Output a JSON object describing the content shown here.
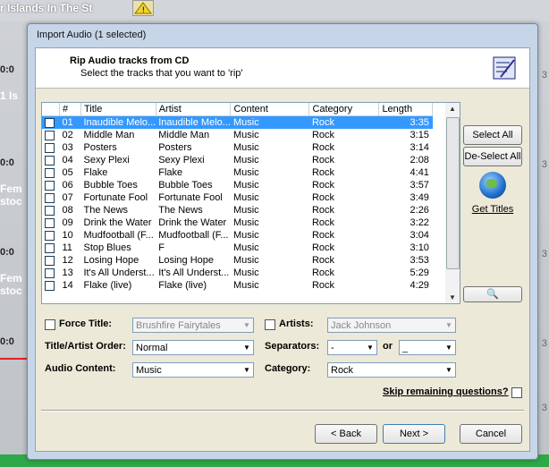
{
  "background": {
    "top_text": "r Islands In The St",
    "times": [
      "0:0",
      "0:0",
      "0:0",
      "0:0"
    ],
    "snippets": [
      "1 Is",
      "Fem",
      "stoc",
      "Fem",
      "stoc"
    ],
    "right_nums": [
      "3",
      "3",
      "3",
      "3",
      "3",
      "3"
    ]
  },
  "dialog": {
    "title": "Import Audio (1 selected)",
    "header": {
      "title": "Rip Audio tracks from CD",
      "subtitle": "Select the tracks that you want to 'rip'"
    },
    "columns": [
      "#",
      "Title",
      "Artist",
      "Content",
      "Category",
      "Length"
    ],
    "tracks": [
      {
        "num": "01",
        "title": "Inaudible Melo...",
        "artist": "Inaudible Melo...",
        "content": "Music",
        "category": "Rock",
        "length": "3:35",
        "selected": true
      },
      {
        "num": "02",
        "title": "Middle Man",
        "artist": "Middle Man",
        "content": "Music",
        "category": "Rock",
        "length": "3:15"
      },
      {
        "num": "03",
        "title": "Posters",
        "artist": "Posters",
        "content": "Music",
        "category": "Rock",
        "length": "3:14"
      },
      {
        "num": "04",
        "title": "Sexy Plexi",
        "artist": "Sexy Plexi",
        "content": "Music",
        "category": "Rock",
        "length": "2:08"
      },
      {
        "num": "05",
        "title": "Flake",
        "artist": "Flake",
        "content": "Music",
        "category": "Rock",
        "length": "4:41"
      },
      {
        "num": "06",
        "title": "Bubble Toes",
        "artist": "Bubble Toes",
        "content": "Music",
        "category": "Rock",
        "length": "3:57"
      },
      {
        "num": "07",
        "title": "Fortunate Fool",
        "artist": "Fortunate Fool",
        "content": "Music",
        "category": "Rock",
        "length": "3:49"
      },
      {
        "num": "08",
        "title": "The News",
        "artist": "The News",
        "content": "Music",
        "category": "Rock",
        "length": "2:26"
      },
      {
        "num": "09",
        "title": "Drink the Water",
        "artist": "Drink the Water",
        "content": "Music",
        "category": "Rock",
        "length": "3:22"
      },
      {
        "num": "10",
        "title": "Mudfootball (F...",
        "artist": "Mudfootball (F...",
        "content": "Music",
        "category": "Rock",
        "length": "3:04"
      },
      {
        "num": "11",
        "title": "Stop Blues",
        "artist": "F",
        "content": "Music",
        "category": "Rock",
        "length": "3:10"
      },
      {
        "num": "12",
        "title": "Losing Hope",
        "artist": "Losing Hope",
        "content": "Music",
        "category": "Rock",
        "length": "3:53"
      },
      {
        "num": "13",
        "title": "It's All Underst...",
        "artist": "It's All Underst...",
        "content": "Music",
        "category": "Rock",
        "length": "5:29"
      },
      {
        "num": "14",
        "title": "Flake (live)",
        "artist": "Flake (live)",
        "content": "Music",
        "category": "Rock",
        "length": "4:29"
      }
    ],
    "buttons": {
      "select_all": "Select All",
      "deselect_all": "De-Select All",
      "get_titles": "Get Titles",
      "back": "< Back",
      "next": "Next >",
      "cancel": "Cancel"
    },
    "form": {
      "force_title_label": "Force Title:",
      "force_title_value": "Brushfire Fairytales",
      "artists_label": "Artists:",
      "artists_value": "Jack Johnson",
      "order_label": "Title/Artist Order:",
      "order_value": "Normal",
      "separators_label": "Separators:",
      "separator1_value": "-",
      "or_label": "or",
      "separator2_value": "_",
      "content_label": "Audio Content:",
      "content_value": "Music",
      "category_label": "Category:",
      "category_value": "Rock",
      "skip_label": "Skip remaining questions?"
    }
  }
}
